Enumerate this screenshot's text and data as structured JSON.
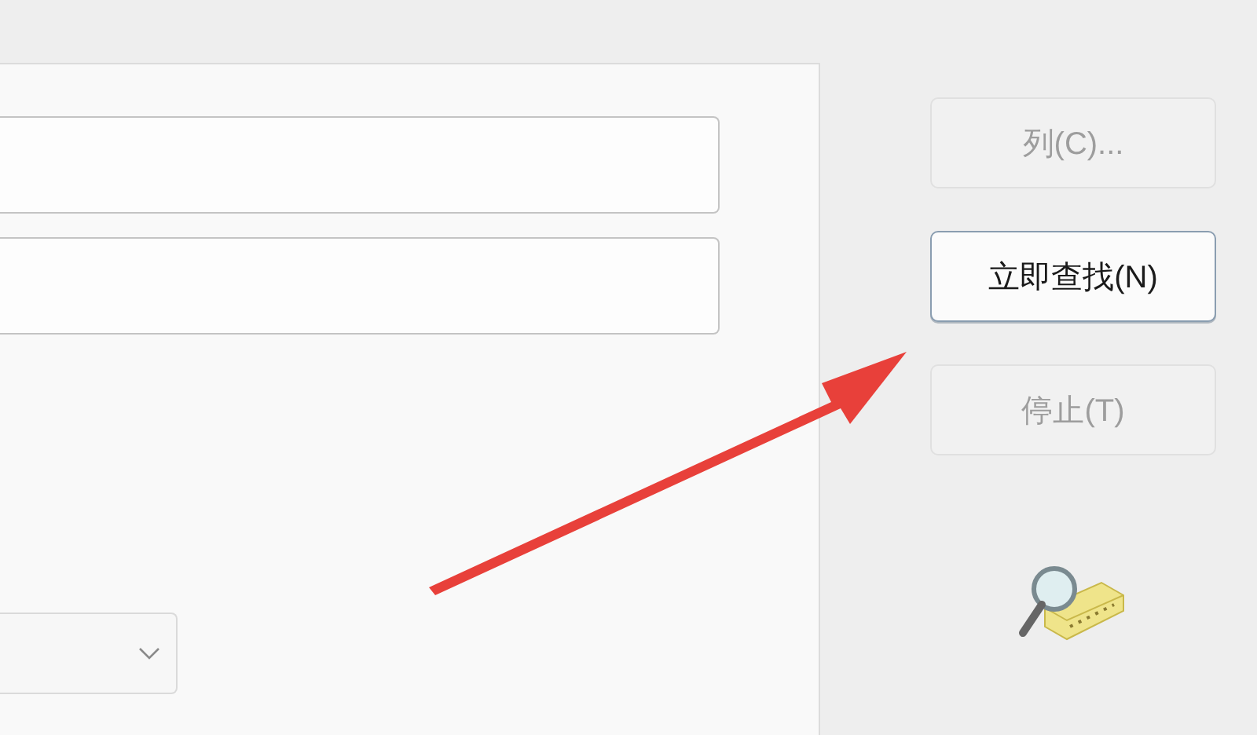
{
  "form": {
    "fields": [
      {
        "kind": "text"
      },
      {
        "kind": "text"
      }
    ],
    "dropdown": {
      "expanded": false
    }
  },
  "buttons": [
    {
      "label": "列(C)...",
      "disabled": true,
      "focused": false
    },
    {
      "label": "立即查找(N)",
      "disabled": false,
      "focused": true
    },
    {
      "label": "停止(T)",
      "disabled": true,
      "focused": false
    }
  ],
  "annotation": {
    "kind": "arrow"
  }
}
